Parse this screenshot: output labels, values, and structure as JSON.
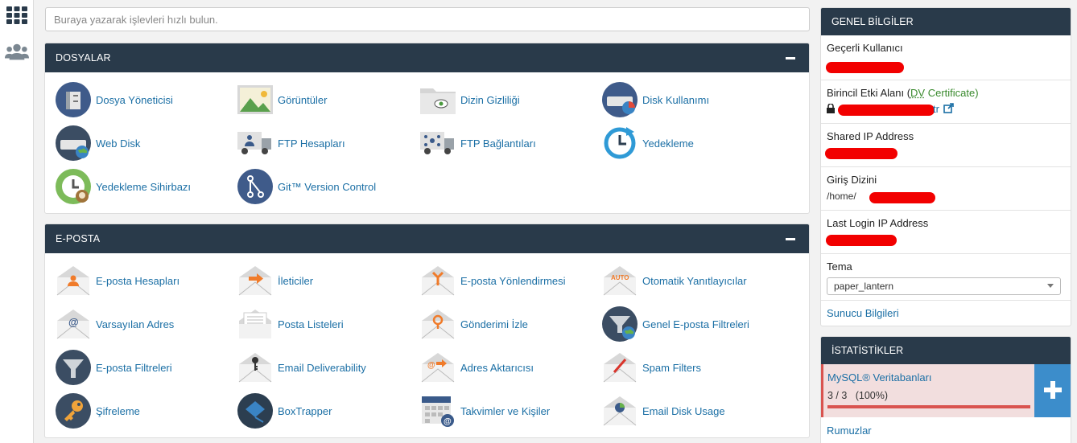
{
  "search": {
    "placeholder": "Buraya yazarak işlevleri hızlı bulun."
  },
  "sections": {
    "files": {
      "title": "DOSYALAR",
      "items": [
        "Dosya Yöneticisi",
        "Görüntüler",
        "Dizin Gizliliği",
        "Disk Kullanımı",
        "Web Disk",
        "FTP Hesapları",
        "FTP Bağlantıları",
        "Yedekleme",
        "Yedekleme Sihirbazı",
        "Git™ Version Control"
      ]
    },
    "email": {
      "title": "E-POSTA",
      "items": [
        "E-posta Hesapları",
        "İleticiler",
        "E-posta Yönlendirmesi",
        "Otomatik Yanıtlayıcılar",
        "Varsayılan Adres",
        "Posta Listeleri",
        "Gönderimi İzle",
        "Genel E-posta Filtreleri",
        "E-posta Filtreleri",
        "Email Deliverability",
        "Adres Aktarıcısı",
        "Spam Filters",
        "Şifreleme",
        "BoxTrapper",
        "Takvimler ve Kişiler",
        "Email Disk Usage"
      ]
    }
  },
  "general_info": {
    "title": "GENEL BİLGİLER",
    "current_user_label": "Geçerli Kullanıcı",
    "primary_domain_label_prefix": "Birincil Etki Alanı (",
    "dv_abbr": "DV",
    "primary_domain_label_suffix": " Certificate)",
    "domain_tail": "tr",
    "shared_ip_label": "Shared IP Address",
    "home_dir_label": "Giriş Dizini",
    "home_dir_value": "/home/",
    "last_login_label": "Last Login IP Address",
    "theme_label": "Tema",
    "theme_value": "paper_lantern",
    "server_info_link": "Sunucu Bilgileri"
  },
  "stats": {
    "title": "İSTATİSTİKLER",
    "mysql_label": "MySQL® Veritabanları",
    "mysql_value": "3 / 3   (100%)",
    "mysql_usage": 1.0,
    "aliases_label": "Rumuzlar"
  },
  "colors": {
    "header_bg": "#293a4a",
    "link": "#1b6fa5",
    "redaction": "#f20000",
    "alert_bg": "#f2dede",
    "plus_button": "#3c8dcb"
  }
}
